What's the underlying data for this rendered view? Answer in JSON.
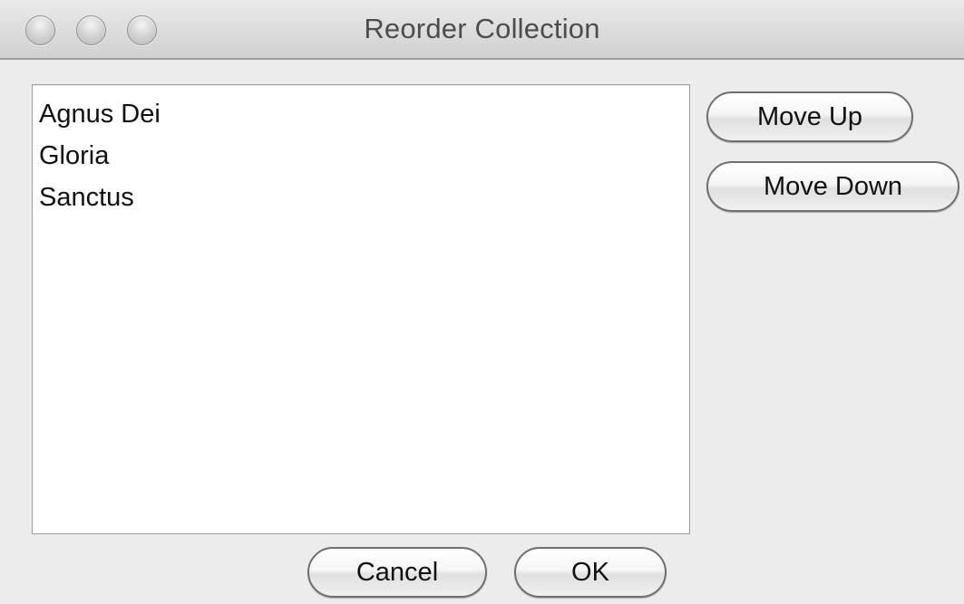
{
  "window": {
    "title": "Reorder Collection"
  },
  "list": {
    "items": [
      "Agnus Dei",
      "Gloria",
      "Sanctus"
    ]
  },
  "buttons": {
    "move_up": "Move Up",
    "move_down": "Move Down",
    "cancel": "Cancel",
    "ok": "OK"
  },
  "colors": {
    "window_background": "#ececec",
    "list_background": "#ffffff",
    "text": "#111111"
  }
}
